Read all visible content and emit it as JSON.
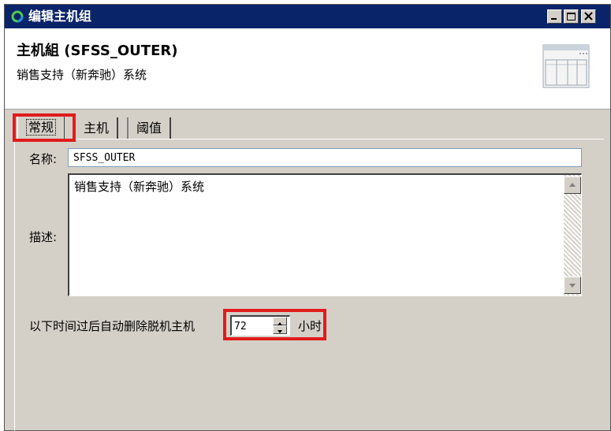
{
  "window": {
    "title": "编辑主机组",
    "icon": "refresh-circle-icon",
    "controls": [
      "minimize-icon",
      "maximize-icon",
      "close-icon"
    ]
  },
  "header": {
    "title": "主机組 (SFSS_OUTER)",
    "subtitle": "销售支持（新奔驰）系统",
    "graphic": "table-window-icon"
  },
  "tabs": [
    {
      "label": "常规",
      "active": true
    },
    {
      "label": "主机",
      "active": false
    },
    {
      "label": "阈值",
      "active": false
    }
  ],
  "form": {
    "name_label": "名称:",
    "name_value": "SFSS_OUTER",
    "desc_label": "描述:",
    "desc_value": "销售支持（新奔驰）系统",
    "auto_delete_label": "以下时间过后自动删除脱机主机",
    "auto_delete_value": "72",
    "auto_delete_unit": "小时"
  },
  "colors": {
    "titlebar": "#0a246a",
    "highlight": "#e11b1b",
    "dialog_bg": "#d4d0c8"
  }
}
